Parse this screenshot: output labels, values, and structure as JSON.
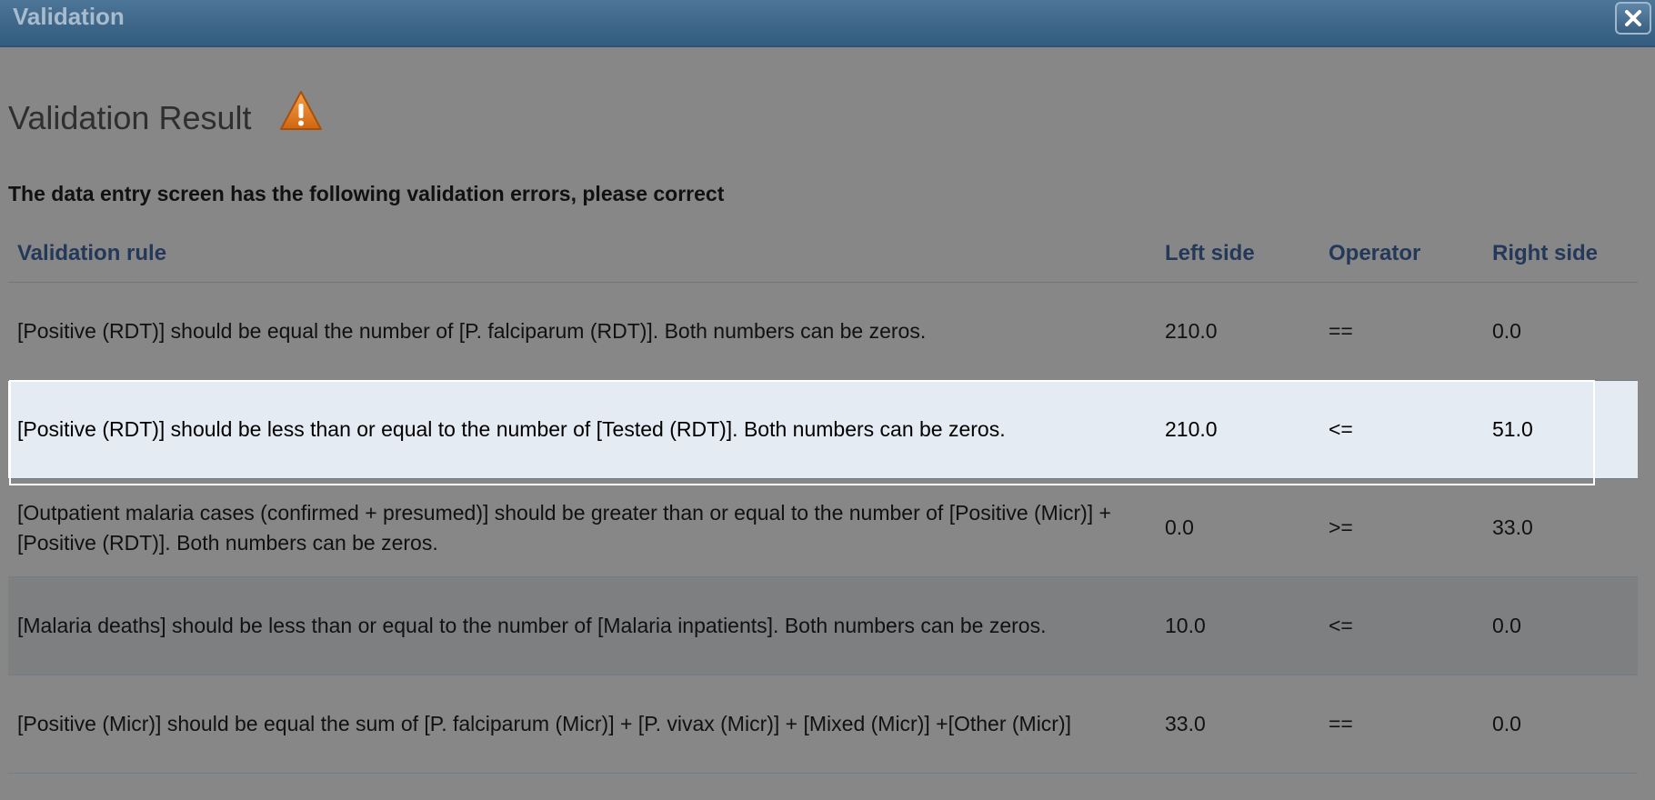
{
  "dialog": {
    "title": "Validation",
    "close_icon": "close-icon"
  },
  "result": {
    "heading": "Validation Result",
    "warning_icon": "warning-icon",
    "subtitle": "The data entry screen has the following validation errors, please correct"
  },
  "table": {
    "columns": [
      "Validation rule",
      "Left side",
      "Operator",
      "Right side"
    ],
    "rows": [
      {
        "rule": "[Positive (RDT)] should be equal the number of [P. falciparum (RDT)]. Both numbers can be zeros.",
        "left": "210.0",
        "operator": "==",
        "right": "0.0"
      },
      {
        "rule": "[Positive (RDT)] should be less than or equal to the number of [Tested (RDT)]. Both numbers can be zeros.",
        "left": "210.0",
        "operator": "<=",
        "right": "51.0"
      },
      {
        "rule": "[Outpatient malaria cases (confirmed + presumed)] should be greater than or equal to the number of [Positive (Micr)] + [Positive (RDT)]. Both numbers can be zeros.",
        "left": "0.0",
        "operator": ">=",
        "right": "33.0"
      },
      {
        "rule": "[Malaria deaths] should be less than or equal to the number of [Malaria inpatients]. Both numbers can be zeros.",
        "left": "10.0",
        "operator": "<=",
        "right": "0.0"
      },
      {
        "rule": "[Positive (Micr)] should be equal the sum of [P. falciparum (Micr)] + [P. vivax (Micr)] + [Mixed (Micr)] +[Other (Micr)]",
        "left": "33.0",
        "operator": "==",
        "right": "0.0"
      }
    ]
  },
  "colors": {
    "titlebar": "#3d6688",
    "header_text": "#24385a",
    "selected_row": "#e4ebf2",
    "warning": "#e07b16"
  }
}
